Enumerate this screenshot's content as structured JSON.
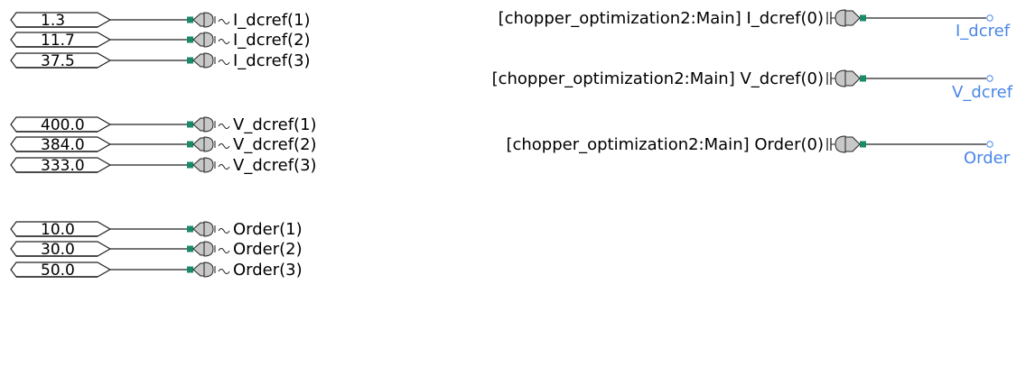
{
  "inputs": [
    {
      "value": "1.3",
      "label": "I_dcref(1)"
    },
    {
      "value": "11.7",
      "label": "I_dcref(2)"
    },
    {
      "value": "37.5",
      "label": "I_dcref(3)"
    },
    {
      "value": "400.0",
      "label": "V_dcref(1)"
    },
    {
      "value": "384.0",
      "label": "V_dcref(2)"
    },
    {
      "value": "333.0",
      "label": "V_dcref(3)"
    },
    {
      "value": "10.0",
      "label": "Order(1)"
    },
    {
      "value": "30.0",
      "label": "Order(2)"
    },
    {
      "value": "50.0",
      "label": "Order(3)"
    }
  ],
  "outputs": [
    {
      "source": "[chopper_optimization2:Main] I_dcref(0)",
      "name": "I_dcref"
    },
    {
      "source": "[chopper_optimization2:Main] V_dcref(0)",
      "name": "V_dcref"
    },
    {
      "source": "[chopper_optimization2:Main] Order(0)",
      "name": "Order"
    }
  ],
  "colors": {
    "line": "#222222",
    "connector_fill": "#c8c8c8",
    "port_green": "#1a8a6a",
    "output_label": "#4a86e8"
  }
}
